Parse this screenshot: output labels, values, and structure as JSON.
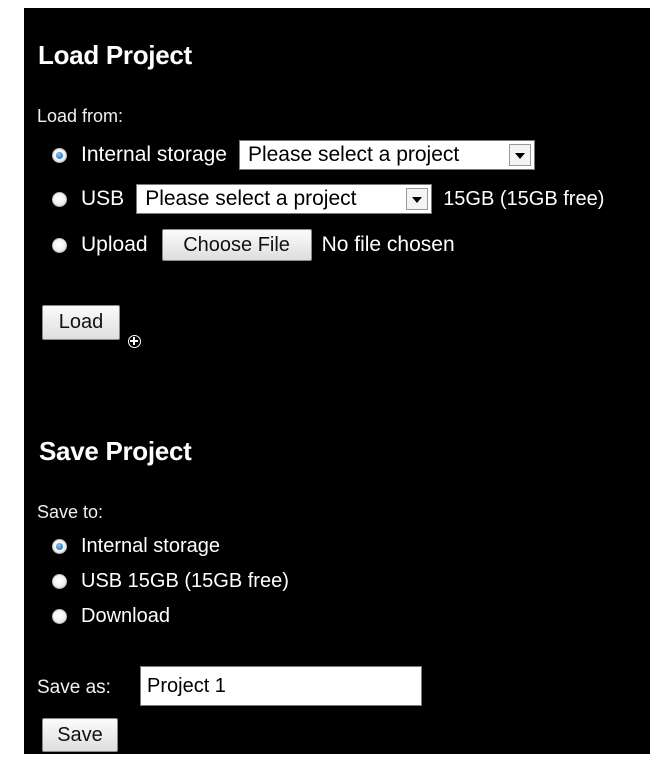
{
  "load": {
    "title": "Load Project",
    "from_label": "Load from:",
    "options": [
      {
        "label": "Internal storage",
        "checked": true,
        "select_value": "Please select a project"
      },
      {
        "label": "USB",
        "checked": false,
        "select_value": "Please select a project",
        "capacity": "15GB (15GB free)"
      },
      {
        "label": "Upload",
        "checked": false,
        "button": "Choose File",
        "status": "No file chosen"
      }
    ],
    "button": "Load"
  },
  "save": {
    "title": "Save Project",
    "to_label": "Save to:",
    "options": [
      {
        "label": "Internal storage",
        "checked": true
      },
      {
        "label": "USB 15GB (15GB free)",
        "checked": false
      },
      {
        "label": "Download",
        "checked": false
      }
    ],
    "save_as_label": "Save as:",
    "save_as_value": "Project 1",
    "button": "Save"
  }
}
